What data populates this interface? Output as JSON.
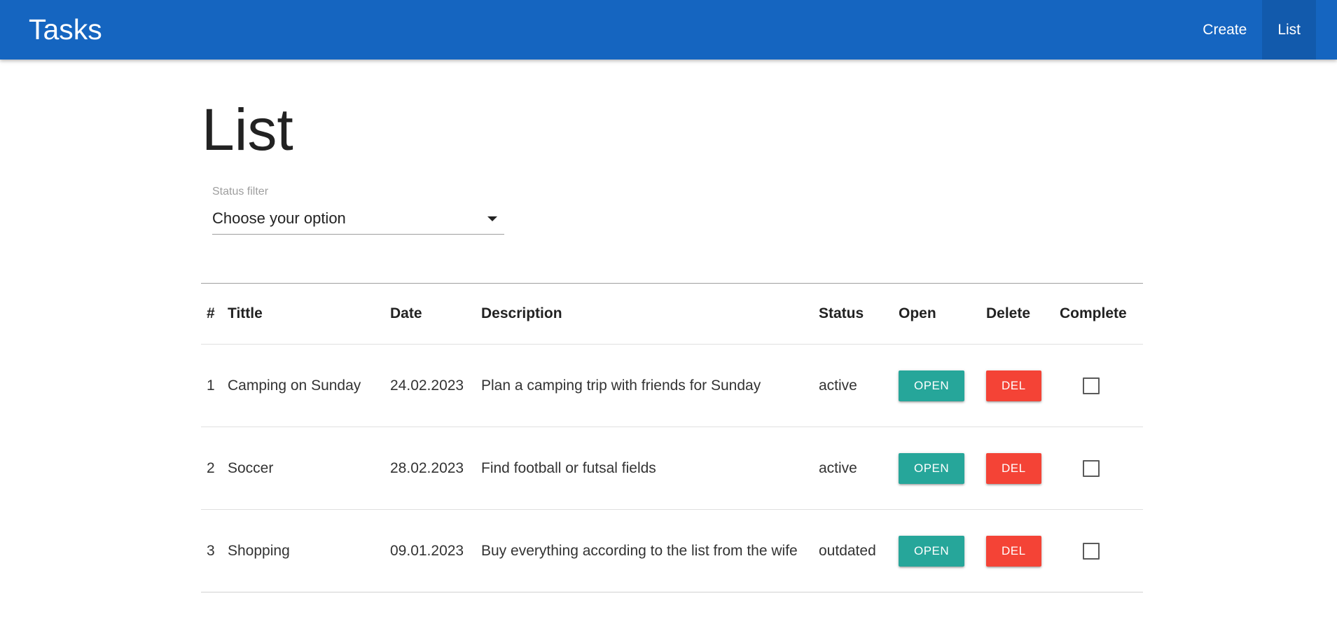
{
  "navbar": {
    "brand": "Tasks",
    "links": [
      {
        "label": "Create",
        "active": false
      },
      {
        "label": "List",
        "active": true
      }
    ]
  },
  "page": {
    "title": "List"
  },
  "status_filter": {
    "label": "Status filter",
    "value": "Choose your option"
  },
  "table": {
    "headers": {
      "num": "#",
      "title": "Tittle",
      "date": "Date",
      "description": "Description",
      "status": "Status",
      "open": "Open",
      "delete": "Delete",
      "complete": "Complete"
    },
    "rows": [
      {
        "num": "1",
        "title": "Camping on Sunday",
        "date": "24.02.2023",
        "description": "Plan a camping trip with friends for Sunday",
        "status": "active",
        "open_label": "OPEN",
        "delete_label": "DEL",
        "complete": false
      },
      {
        "num": "2",
        "title": "Soccer",
        "date": "28.02.2023",
        "description": "Find football or futsal fields",
        "status": "active",
        "open_label": "OPEN",
        "delete_label": "DEL",
        "complete": false
      },
      {
        "num": "3",
        "title": "Shopping",
        "date": "09.01.2023",
        "description": "Buy everything according to the list from the wife",
        "status": "outdated",
        "open_label": "OPEN",
        "delete_label": "DEL",
        "complete": false
      }
    ]
  },
  "colors": {
    "navbar": "#1565c0",
    "open_button": "#26a69a",
    "delete_button": "#f44336"
  }
}
